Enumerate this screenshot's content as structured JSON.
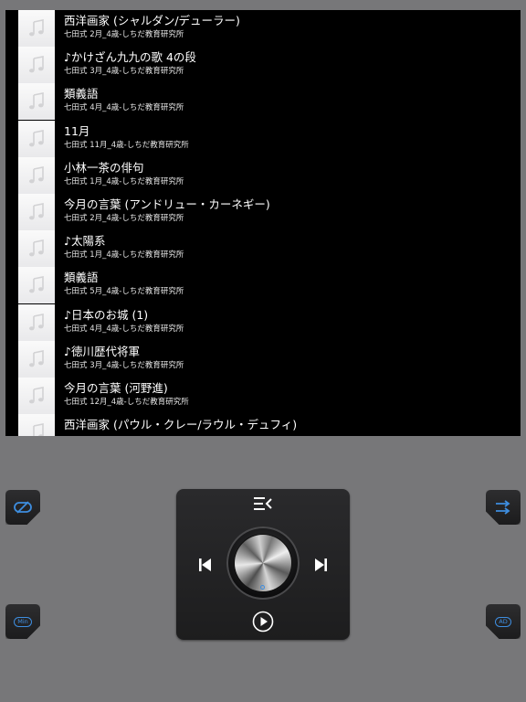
{
  "playlist": [
    {
      "title": "西洋画家 (シャルダン/デューラー)",
      "subtitle": "七田式 2月_4歳-しちだ教育研究所"
    },
    {
      "title": "♪かけざん九九の歌 4の段",
      "subtitle": "七田式 3月_4歳-しちだ教育研究所"
    },
    {
      "title": "類義語",
      "subtitle": "七田式 4月_4歳-しちだ教育研究所"
    },
    {
      "title": "11月",
      "subtitle": "七田式 11月_4歳-しちだ教育研究所"
    },
    {
      "title": "小林一茶の俳句",
      "subtitle": "七田式 1月_4歳-しちだ教育研究所"
    },
    {
      "title": "今月の言葉 (アンドリュー・カーネギー)",
      "subtitle": "七田式 2月_4歳-しちだ教育研究所"
    },
    {
      "title": "♪太陽系",
      "subtitle": "七田式 1月_4歳-しちだ教育研究所"
    },
    {
      "title": "類義語",
      "subtitle": "七田式 5月_4歳-しちだ教育研究所"
    },
    {
      "title": "♪日本のお城 (1)",
      "subtitle": "七田式 4月_4歳-しちだ教育研究所"
    },
    {
      "title": "♪徳川歴代将軍",
      "subtitle": "七田式 3月_4歳-しちだ教育研究所"
    },
    {
      "title": "今月の言葉 (河野進)",
      "subtitle": "七田式 12月_4歳-しちだ教育研究所"
    },
    {
      "title": "西洋画家 (パウル・クレー/ラウル・デュフィ)",
      "subtitle": ""
    }
  ],
  "buttons": {
    "min_label": "Min",
    "ad_label": "AD"
  },
  "icons": {
    "track": "music-note-icon",
    "top_left": "no-repeat-icon",
    "top_right": "shuffle-icon",
    "player_top": "playlist-icon",
    "prev": "skip-previous-icon",
    "next": "skip-next-icon",
    "play": "play-icon"
  },
  "colors": {
    "accent": "#3e8ee0",
    "background": "#777779",
    "panel": "#000000"
  }
}
